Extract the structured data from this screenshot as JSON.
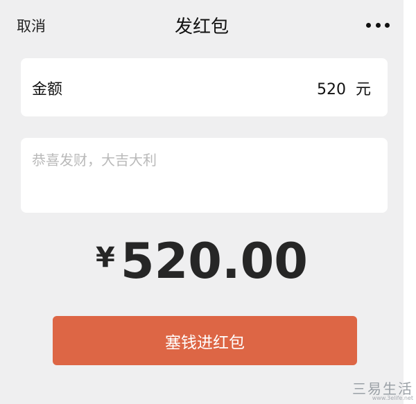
{
  "nav": {
    "cancel_label": "取消",
    "title": "发红包",
    "more_icon": "more-icon"
  },
  "amount": {
    "label": "金额",
    "value": "520",
    "unit": "元"
  },
  "message": {
    "placeholder": "恭喜发财，大吉大利"
  },
  "total": {
    "currency_symbol": "¥",
    "value": "520.00"
  },
  "submit": {
    "label": "塞钱进红包"
  },
  "colors": {
    "background": "#efeff0",
    "card": "#ffffff",
    "button": "#dd6645",
    "button_text": "#ffffff"
  },
  "watermark": {
    "text": "三易生活",
    "url": "www.3elife.net"
  }
}
